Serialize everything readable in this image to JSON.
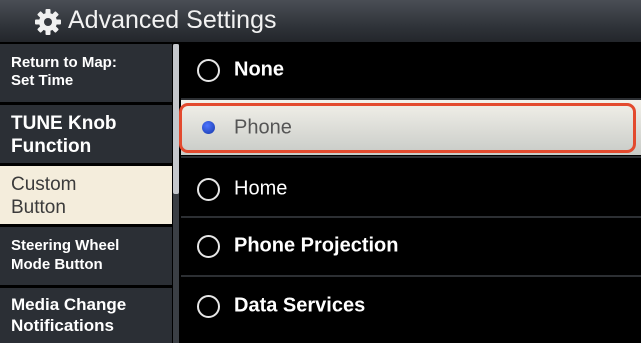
{
  "header": {
    "title": "Advanced Settings",
    "icon": "gear-icon"
  },
  "sidebar": {
    "items": [
      {
        "line1": "Return to Map:",
        "line2": "Set Time"
      },
      {
        "line1": "TUNE Knob",
        "line2": "Function"
      },
      {
        "line1": "Custom",
        "line2": "Button",
        "selected": true
      },
      {
        "line1": "Steering Wheel",
        "line2": "Mode Button"
      },
      {
        "line1": "Media Change",
        "line2": "Notifications"
      }
    ]
  },
  "options": [
    {
      "label": "None",
      "selected": false
    },
    {
      "label": "Phone",
      "selected": true
    },
    {
      "label": "Home",
      "selected": false
    },
    {
      "label": "Phone Projection",
      "selected": false
    },
    {
      "label": "Data Services",
      "selected": false
    }
  ],
  "colors": {
    "highlight_border": "#e34a2e",
    "radio_selected": "#1c44b6",
    "selected_background": "#f4eddc"
  }
}
